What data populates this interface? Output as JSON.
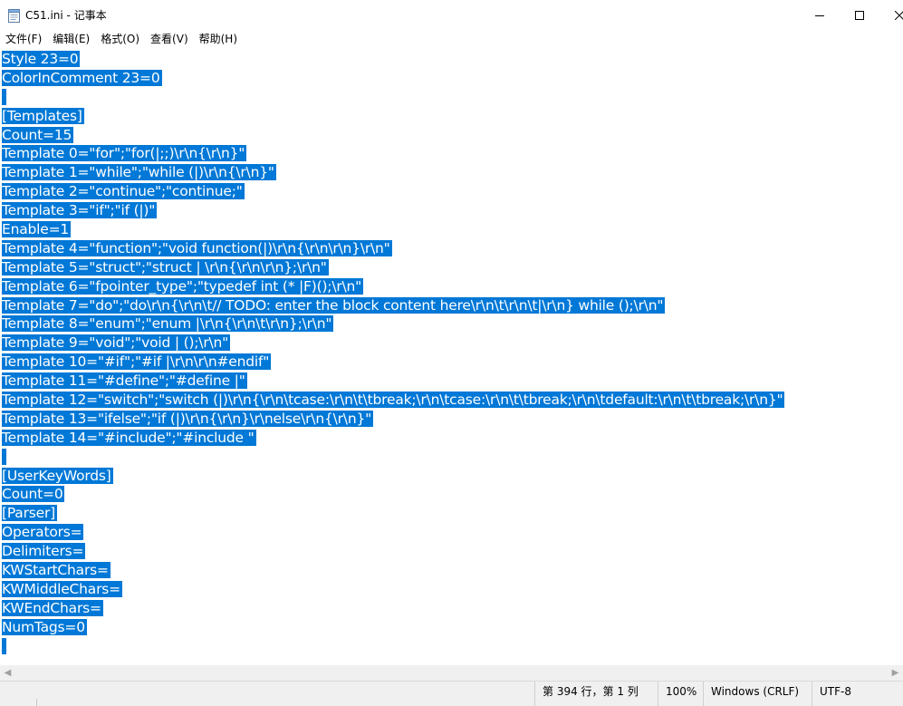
{
  "window": {
    "title": "C51.ini - 记事本",
    "icon": "notepad-icon"
  },
  "menu": {
    "items": [
      "文件(F)",
      "编辑(E)",
      "格式(O)",
      "查看(V)",
      "帮助(H)"
    ]
  },
  "editor": {
    "lines": [
      "Style 23=0",
      "ColorInComment 23=0",
      "",
      "[Templates]",
      "Count=15",
      "Template 0=\"for\";\"for(|;;)\\r\\n{\\r\\n}\"",
      "Template 1=\"while\";\"while (|)\\r\\n{\\r\\n}\"",
      "Template 2=\"continue\";\"continue;\"",
      "Template 3=\"if\";\"if (|)\"",
      "Enable=1",
      "Template 4=\"function\";\"void function(|)\\r\\n{\\r\\n\\r\\n}\\r\\n\"",
      "Template 5=\"struct\";\"struct | \\r\\n{\\r\\n\\r\\n};\\r\\n\"",
      "Template 6=\"fpointer_type\";\"typedef int (* |F)();\\r\\n\"",
      "Template 7=\"do\";\"do\\r\\n{\\r\\n\\t// TODO: enter the block content here\\r\\n\\t\\r\\n\\t|\\r\\n} while ();\\r\\n\"",
      "Template 8=\"enum\";\"enum |\\r\\n{\\r\\n\\t\\r\\n};\\r\\n\"",
      "Template 9=\"void\";\"void | ();\\r\\n\"",
      "Template 10=\"#if\";\"#if |\\r\\n\\r\\n#endif\"",
      "Template 11=\"#define\";\"#define |\"",
      "Template 12=\"switch\";\"switch (|)\\r\\n{\\r\\n\\tcase:\\r\\n\\t\\tbreak;\\r\\n\\tcase:\\r\\n\\t\\tbreak;\\r\\n\\tdefault:\\r\\n\\t\\tbreak;\\r\\n}\"",
      "Template 13=\"ifelse\";\"if (|)\\r\\n{\\r\\n}\\r\\nelse\\r\\n{\\r\\n}\"",
      "Template 14=\"#include\";\"#include \"",
      "",
      "[UserKeyWords]",
      "Count=0",
      "[Parser]",
      "Operators=",
      "Delimiters=",
      "KWStartChars=",
      "KWMiddleChars=",
      "KWEndChars=",
      "NumTags=0",
      ""
    ],
    "selection_color": "#0078d7"
  },
  "status": {
    "position": "第 394 行，第 1 列",
    "zoom": "100%",
    "line_ending": "Windows (CRLF)",
    "encoding": "UTF-8"
  }
}
